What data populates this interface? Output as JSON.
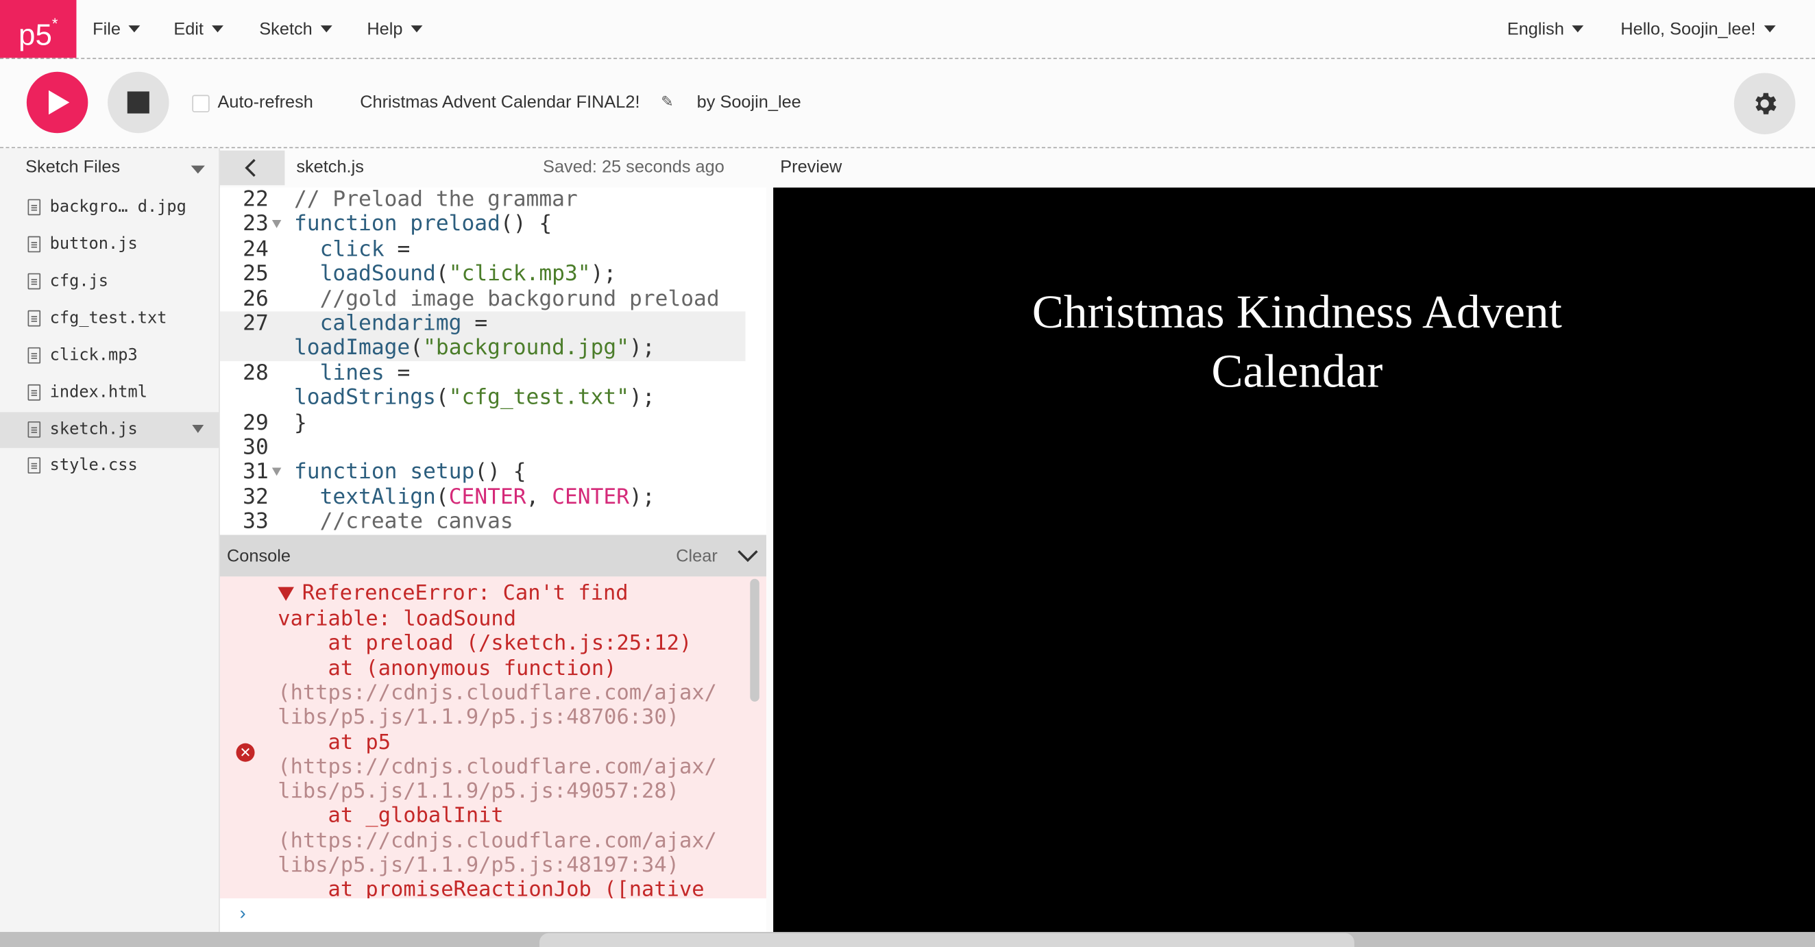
{
  "nav": {
    "logo": "p5",
    "logo_sup": "*",
    "menus": [
      "File",
      "Edit",
      "Sketch",
      "Help"
    ],
    "language": "English",
    "user": "Hello, Soojin_lee!"
  },
  "toolbar": {
    "auto_refresh_label": "Auto-refresh",
    "sketch_name": "Christmas Advent Calendar FINAL2!",
    "by_line": "by Soojin_lee"
  },
  "sidebar": {
    "title": "Sketch Files",
    "files": [
      "backgro… d.jpg",
      "button.js",
      "cfg.js",
      "cfg_test.txt",
      "click.mp3",
      "index.html",
      "sketch.js",
      "style.css"
    ],
    "selected": "sketch.js"
  },
  "editor": {
    "tab": "sketch.js",
    "saved": "Saved: 25 seconds ago",
    "line_numbers": [
      "22",
      "23",
      "24",
      "25",
      "26",
      "27",
      "28",
      "29",
      "30",
      "31",
      "32",
      "33"
    ],
    "lines": [
      "// Preload the grammar",
      "function preload() {",
      "  click =",
      "  loadSound(\"click.mp3\");",
      "  //gold image backgorund preload",
      "  calendarimg =",
      "loadImage(\"background.jpg\");",
      "  lines =",
      "loadStrings(\"cfg_test.txt\");",
      "}",
      "",
      "function setup() {",
      "  textAlign(CENTER, CENTER);",
      "  //create canvas"
    ]
  },
  "console": {
    "title": "Console",
    "clear": "Clear",
    "lines": [
      "ReferenceError: Can't find",
      "variable: loadSound",
      "    at preload (/sketch.js:25:12)",
      "    at (anonymous function)",
      "(https://cdnjs.cloudflare.com/ajax/",
      "libs/p5.js/1.1.9/p5.js:48706:30)",
      "    at p5",
      "(https://cdnjs.cloudflare.com/ajax/",
      "libs/p5.js/1.1.9/p5.js:49057:28)",
      "    at _globalInit",
      "(https://cdnjs.cloudflare.com/ajax/",
      "libs/p5.js/1.1.9/p5.js:48197:34)",
      "    at promiseReactionJob ([native"
    ],
    "prompt": "›"
  },
  "preview": {
    "label": "Preview",
    "title_line1": "Christmas Kindness Advent",
    "title_line2": "Calendar"
  },
  "colors": {
    "accent": "#ed225d",
    "error_text": "#c42727",
    "error_bg": "#fde9ea",
    "keyword": "#2c5e7e",
    "string": "#4b7d2a",
    "constant": "#d52a79"
  }
}
